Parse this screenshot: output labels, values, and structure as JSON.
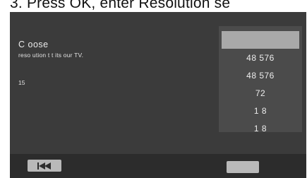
{
  "caption": "3. Press OK, enter Resolution se",
  "dialog": {
    "title": "C oose",
    "subtitle": "reso ution t   t its   our TV.",
    "current_value": "15"
  },
  "resolution_list": {
    "items": [
      "",
      "48   576",
      "48   576",
      "72",
      "1  8",
      "1  8"
    ],
    "selected_index": 0
  },
  "colors": {
    "screen_bg": "#3b3b3b",
    "list_bg": "#4b4b4b",
    "selected_bg": "#a9a9a9",
    "bottom_bar": "#2c2c2c",
    "button_bg": "#b9b9b9"
  },
  "icons": {
    "prev": "skip-to-start-icon"
  }
}
